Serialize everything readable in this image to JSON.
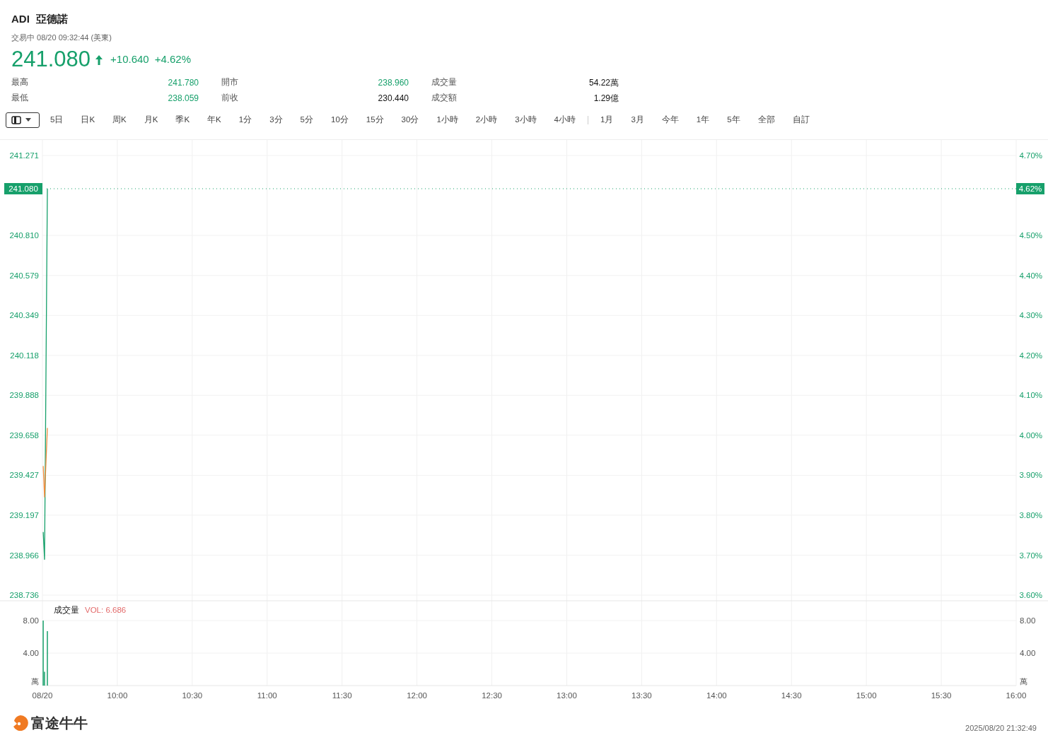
{
  "header": {
    "symbol": "ADI",
    "name": "亞德諾",
    "status": "交易中 08/20 09:32:44 (美東)",
    "price": "241.080",
    "change": "+10.640",
    "change_percent": "+4.62%"
  },
  "stats": [
    {
      "label": "最高",
      "value": "241.780",
      "color": "#17a06b"
    },
    {
      "label": "開市",
      "value": "238.960",
      "color": "#17a06b"
    },
    {
      "label": "成交量",
      "value": "54.22萬",
      "color": "#111111"
    },
    {
      "label": "最低",
      "value": "238.059",
      "color": "#17a06b"
    },
    {
      "label": "前收",
      "value": "230.440",
      "color": "#111111"
    },
    {
      "label": "成交額",
      "value": "1.29億",
      "color": "#111111"
    }
  ],
  "toolbar": {
    "periods": [
      {
        "label": "5日",
        "selected": false
      },
      {
        "label": "日K",
        "selected": false
      },
      {
        "label": "周K",
        "selected": false
      },
      {
        "label": "月K",
        "selected": false
      },
      {
        "label": "季K",
        "selected": false
      },
      {
        "label": "年K",
        "selected": false
      },
      {
        "label": "1分",
        "selected": false
      },
      {
        "label": "3分",
        "selected": false
      },
      {
        "label": "5分",
        "selected": false
      },
      {
        "label": "10分",
        "selected": false
      },
      {
        "label": "15分",
        "selected": false
      },
      {
        "label": "30分",
        "selected": false
      },
      {
        "label": "1小時",
        "selected": false
      },
      {
        "label": "2小時",
        "selected": false
      },
      {
        "label": "3小時",
        "selected": false
      },
      {
        "label": "4小時",
        "selected": false
      }
    ],
    "ranges": [
      {
        "label": "1月",
        "selected": false
      },
      {
        "label": "3月",
        "selected": false
      },
      {
        "label": "今年",
        "selected": false
      },
      {
        "label": "1年",
        "selected": false
      },
      {
        "label": "5年",
        "selected": false
      },
      {
        "label": "全部",
        "selected": false
      },
      {
        "label": "自訂",
        "selected": false
      }
    ]
  },
  "price_chart": {
    "last_price_label": "241.080",
    "last_percent_label": "4.62%",
    "right_axis_labels": [
      "4.70%",
      "4.50%",
      "4.40%",
      "4.30%",
      "4.20%",
      "4.10%",
      "4.00%",
      "3.90%",
      "3.80%",
      "3.70%",
      "3.60%"
    ],
    "chart_data": {
      "type": "line",
      "grid": true,
      "x": [
        9.505,
        9.514,
        9.533
      ],
      "xlim": [
        9.5,
        16
      ],
      "ylim": [
        238.736,
        241.271
      ],
      "yticks": [
        {
          "value": 241.271,
          "label": "241.271"
        },
        {
          "value": 240.81,
          "label": "240.810"
        },
        {
          "value": 240.579,
          "label": "240.579"
        },
        {
          "value": 240.349,
          "label": "240.349"
        },
        {
          "value": 240.118,
          "label": "240.118"
        },
        {
          "value": 239.888,
          "label": "239.888"
        },
        {
          "value": 239.658,
          "label": "239.658"
        },
        {
          "value": 239.427,
          "label": "239.427"
        },
        {
          "value": 239.197,
          "label": "239.197"
        },
        {
          "value": 238.966,
          "label": "238.966"
        },
        {
          "value": 238.736,
          "label": "238.736"
        }
      ],
      "series": [
        {
          "color": "#17a06b",
          "values": [
            239.1,
            238.94,
            241.08
          ]
        },
        {
          "color": "#ef8b3c",
          "values": [
            239.48,
            239.3,
            239.7
          ]
        }
      ]
    }
  },
  "volume_chart": {
    "title": "成交量",
    "indicator": "VOL: 6.686",
    "unit_left": "萬",
    "unit_right": "萬",
    "right_axis_labels": [
      "8.00",
      "4.00"
    ],
    "chart_data": {
      "type": "bar",
      "grid": true,
      "x": [
        9.505,
        9.514,
        9.533
      ],
      "xlim": [
        9.5,
        16
      ],
      "ylim": [
        0,
        8
      ],
      "yticks": [
        {
          "value": 8,
          "label": "8.00"
        },
        {
          "value": 4,
          "label": "4.00"
        }
      ],
      "xticks": [
        {
          "value": 9.5,
          "label": "08/20"
        },
        {
          "value": 10,
          "label": "10:00"
        },
        {
          "value": 10.5,
          "label": "10:30"
        },
        {
          "value": 11,
          "label": "11:00"
        },
        {
          "value": 11.5,
          "label": "11:30"
        },
        {
          "value": 12,
          "label": "12:00"
        },
        {
          "value": 12.5,
          "label": "12:30"
        },
        {
          "value": 13,
          "label": "13:00"
        },
        {
          "value": 13.5,
          "label": "13:30"
        },
        {
          "value": 14,
          "label": "14:00"
        },
        {
          "value": 14.5,
          "label": "14:30"
        },
        {
          "value": 15,
          "label": "15:00"
        },
        {
          "value": 15.5,
          "label": "15:30"
        },
        {
          "value": 16,
          "label": "16:00"
        }
      ],
      "series": [
        {
          "color": "#17a06b",
          "values": [
            8.0,
            1.7,
            6.7
          ]
        }
      ]
    }
  },
  "footer": {
    "brand": "富途牛牛",
    "timestamp": "2025/08/20 21:32:49"
  }
}
